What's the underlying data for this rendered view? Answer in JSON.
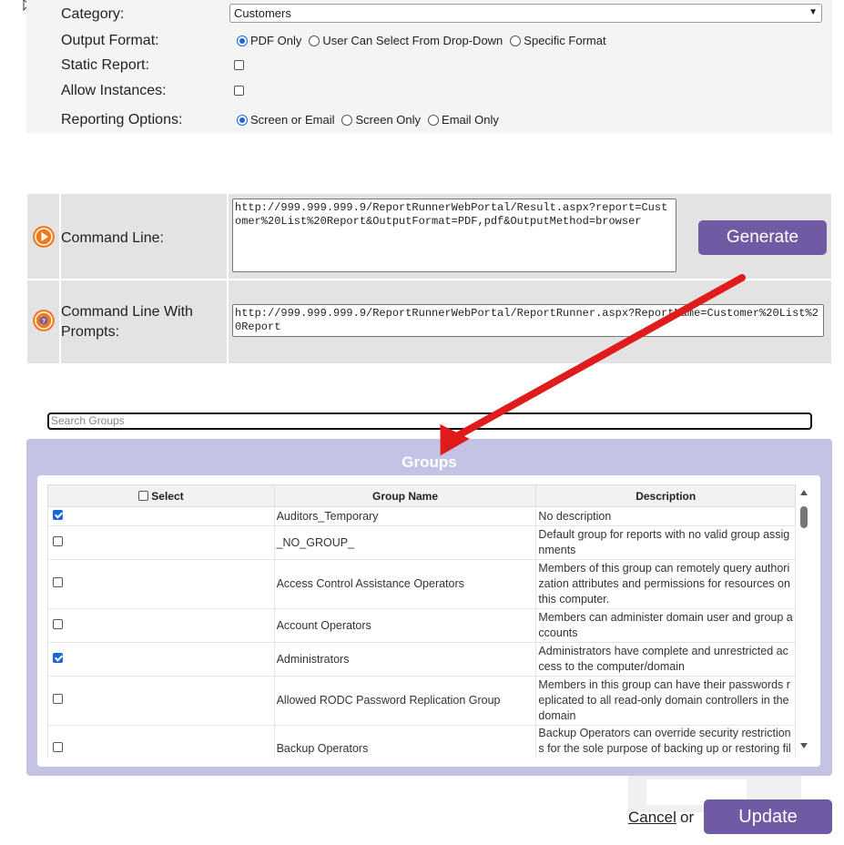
{
  "settings": {
    "category_label": "Category:",
    "category_value": "Customers",
    "output_format_label": "Output Format:",
    "output_options": [
      "PDF Only",
      "User Can Select From Drop-Down",
      "Specific Format"
    ],
    "static_report_label": "Static Report:",
    "allow_instances_label": "Allow Instances:",
    "reporting_options_label": "Reporting Options:",
    "reporting_options": [
      "Screen or Email",
      "Screen Only",
      "Email Only"
    ]
  },
  "command": {
    "label": "Command Line:",
    "url": "http://999.999.999.9/ReportRunnerWebPortal/Result.aspx?report=Customer%20List%20Report&OutputFormat=PDF,pdf&OutputMethod=browser",
    "generate_label": "Generate",
    "prompts_label": "Command Line With Prompts:",
    "prompts_url": "http://999.999.999.9/ReportRunnerWebPortal/ReportRunner.aspx?ReportName=Customer%20List%20Report"
  },
  "search": {
    "placeholder": "Search Groups"
  },
  "groups": {
    "title": "Groups",
    "columns": [
      "Select",
      "Group Name",
      "Description"
    ],
    "rows": [
      {
        "checked": true,
        "name": "Auditors_Temporary",
        "desc": "No description"
      },
      {
        "checked": false,
        "name": "_NO_GROUP_",
        "desc": "Default group for reports with no valid group assignments"
      },
      {
        "checked": false,
        "name": "Access Control Assistance Operators",
        "desc": "Members of this group can remotely query authorization attributes and permissions for resources on this computer."
      },
      {
        "checked": false,
        "name": "Account Operators",
        "desc": "Members can administer domain user and group accounts"
      },
      {
        "checked": true,
        "name": "Administrators",
        "desc": "Administrators have complete and unrestricted access to the computer/domain"
      },
      {
        "checked": false,
        "name": "Allowed RODC Password Replication Group",
        "desc": "Members in this group can have their passwords replicated to all read-only domain controllers in the domain"
      },
      {
        "checked": false,
        "name": "Backup Operators",
        "desc": "Backup Operators can override security restrictions for the sole purpose of backing up or restoring files"
      }
    ]
  },
  "footer": {
    "cancel_label": "Cancel",
    "or_text": "or",
    "update_label": "Update"
  },
  "colors": {
    "accent": "#6f5aa3",
    "panel": "#c4c2e5",
    "annotation_arrow": "#e01b1b",
    "icon": "#f07a1a"
  }
}
